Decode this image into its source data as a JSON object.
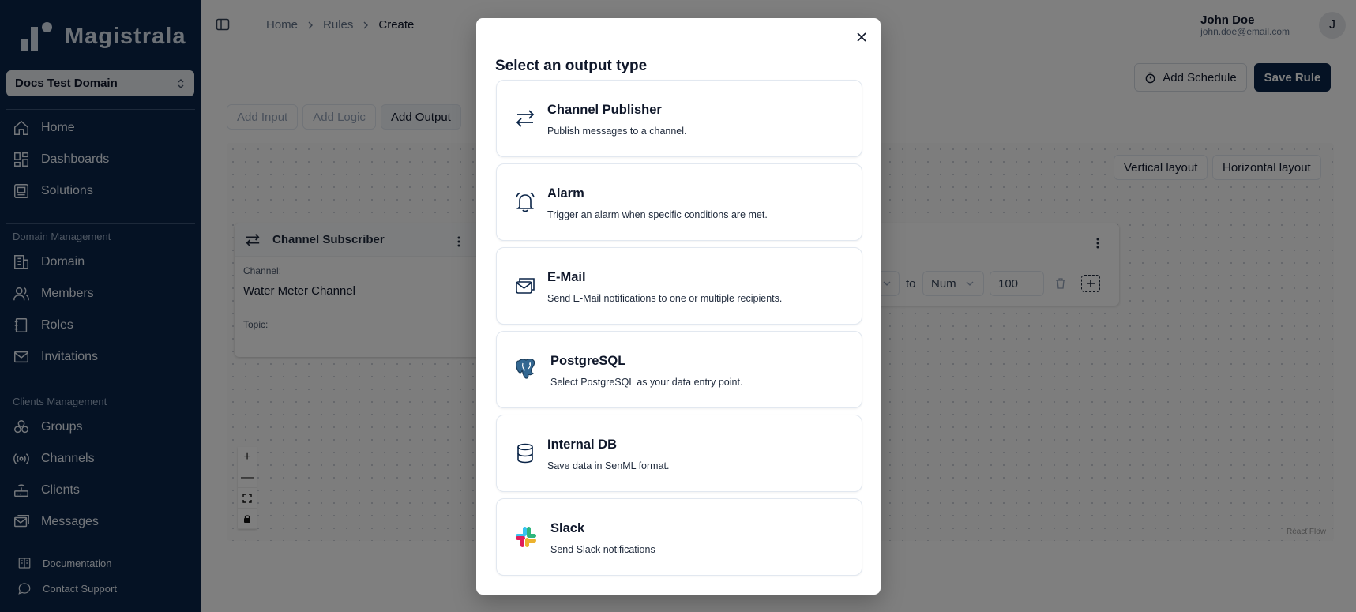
{
  "app": {
    "name": "Magistrala",
    "domain": "Docs Test Domain"
  },
  "sidebar": {
    "items": [
      {
        "label": "Home",
        "icon": "home-icon"
      },
      {
        "label": "Dashboards",
        "icon": "dashboard-icon"
      },
      {
        "label": "Solutions",
        "icon": "solutions-icon"
      }
    ],
    "domain_section": "Domain Management",
    "domain_items": [
      {
        "label": "Domain",
        "icon": "domain-icon"
      },
      {
        "label": "Members",
        "icon": "members-icon"
      },
      {
        "label": "Roles",
        "icon": "roles-icon"
      },
      {
        "label": "Invitations",
        "icon": "mail-icon"
      }
    ],
    "clients_section": "Clients Management",
    "clients_items": [
      {
        "label": "Groups",
        "icon": "groups-icon"
      },
      {
        "label": "Channels",
        "icon": "channels-icon"
      },
      {
        "label": "Clients",
        "icon": "clients-icon"
      },
      {
        "label": "Messages",
        "icon": "messages-icon"
      }
    ],
    "footer_items": [
      {
        "label": "Documentation",
        "icon": "book-icon"
      },
      {
        "label": "Contact Support",
        "icon": "chat-icon"
      }
    ]
  },
  "header": {
    "breadcrumb": [
      "Home",
      "Rules",
      "Create"
    ],
    "user_name": "John Doe",
    "user_email": "john.doe@email.com",
    "avatar_letter": "J"
  },
  "toolbar": {
    "add_schedule": "Add Schedule",
    "save_rule": "Save Rule",
    "tabs": [
      "Add Input",
      "Add Logic",
      "Add Output"
    ],
    "active_tab": "Add Output",
    "vertical_layout": "Vertical layout",
    "horizontal_layout": "Horizontal layout"
  },
  "flow": {
    "input_node": {
      "title": "Channel Subscriber",
      "channel_label": "Channel:",
      "channel_value": "Water Meter Channel",
      "topic_label": "Topic:"
    },
    "logic_node": {
      "to_label": "to",
      "type_value": "Num",
      "number_value": "100"
    },
    "zoom_controls": [
      "+",
      "—",
      "⛶",
      "🔒"
    ],
    "attribution": "React Flow"
  },
  "modal": {
    "title": "Select an output type",
    "options": [
      {
        "title": "Channel Publisher",
        "desc": "Publish messages to a channel.",
        "icon": "arrows-exchange-icon"
      },
      {
        "title": "Alarm",
        "desc": "Trigger an alarm when specific conditions are met.",
        "icon": "bell-icon"
      },
      {
        "title": "E-Mail",
        "desc": "Send E-Mail notifications to one or multiple recipients.",
        "icon": "email-icon"
      },
      {
        "title": "PostgreSQL",
        "desc": "Select PostgreSQL as your data entry point.",
        "icon": "postgresql-icon"
      },
      {
        "title": "Internal DB",
        "desc": "Save data in SenML format.",
        "icon": "database-icon"
      },
      {
        "title": "Slack",
        "desc": "Send Slack notifications",
        "icon": "slack-icon"
      }
    ]
  },
  "colors": {
    "sidebar_bg": "#0b2548",
    "primary": "#0b2548",
    "overlay": "rgba(0,0,0,0.5)"
  }
}
